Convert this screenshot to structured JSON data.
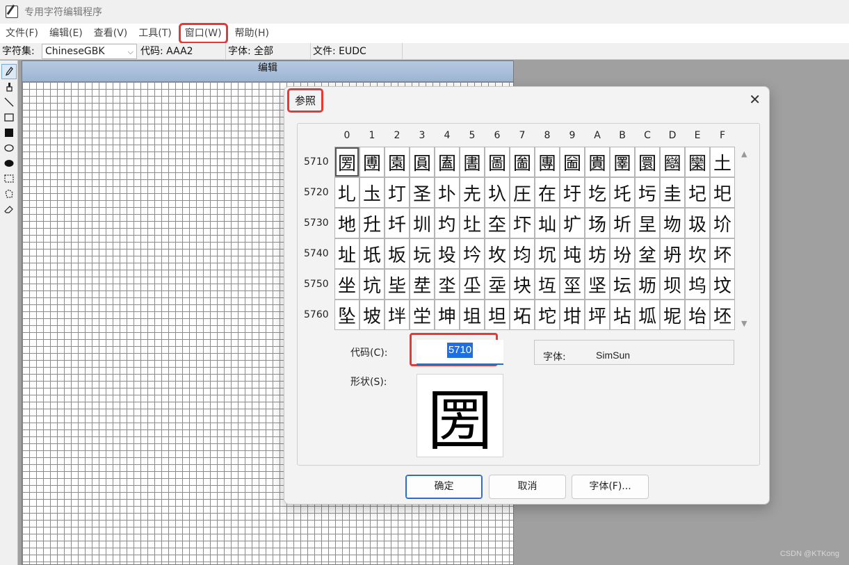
{
  "app": {
    "title": "专用字符编辑程序"
  },
  "menu": [
    {
      "label": "文件(F)"
    },
    {
      "label": "编辑(E)"
    },
    {
      "label": "查看(V)"
    },
    {
      "label": "工具(T)"
    },
    {
      "label": "窗口(W)"
    },
    {
      "label": "帮助(H)"
    }
  ],
  "infobar": {
    "charset_label": "字符集:",
    "charset_value": "ChineseGBK",
    "code": "代码: AAA2",
    "font": "字体: 全部",
    "file": "文件: EUDC"
  },
  "toolbar": {
    "tools": [
      "pencil-icon",
      "brush-icon",
      "line-icon",
      "hollow-rect-icon",
      "filled-rect-icon",
      "hollow-ellipse-icon",
      "filled-ellipse-icon",
      "rect-select-icon",
      "freeform-select-icon",
      "eraser-icon"
    ]
  },
  "edit": {
    "header": "编辑"
  },
  "dialog": {
    "title": "参照",
    "close": "✕",
    "columns": [
      "0",
      "1",
      "2",
      "3",
      "4",
      "5",
      "6",
      "7",
      "8",
      "9",
      "A",
      "B",
      "C",
      "D",
      "E",
      "F"
    ],
    "rows": [
      {
        "code": "5710",
        "chars": [
          "圐",
          "圑",
          "園",
          "圓",
          "圔",
          "圕",
          "圖",
          "圗",
          "團",
          "圙",
          "圚",
          "圛",
          "圜",
          "圝",
          "圞",
          "土"
        ]
      },
      {
        "code": "5720",
        "chars": [
          "圠",
          "圡",
          "圢",
          "圣",
          "圤",
          "圥",
          "圦",
          "圧",
          "在",
          "圩",
          "圪",
          "圫",
          "圬",
          "圭",
          "圮",
          "圯"
        ]
      },
      {
        "code": "5730",
        "chars": [
          "地",
          "圱",
          "圲",
          "圳",
          "圴",
          "圵",
          "圶",
          "圷",
          "圸",
          "圹",
          "场",
          "圻",
          "圼",
          "圽",
          "圾",
          "圿"
        ]
      },
      {
        "code": "5740",
        "chars": [
          "址",
          "坁",
          "坂",
          "坃",
          "坄",
          "坅",
          "坆",
          "均",
          "坈",
          "坉",
          "坊",
          "坋",
          "坌",
          "坍",
          "坎",
          "坏"
        ]
      },
      {
        "code": "5750",
        "chars": [
          "坐",
          "坑",
          "坒",
          "坓",
          "坔",
          "坕",
          "坖",
          "块",
          "坘",
          "坙",
          "坚",
          "坛",
          "坜",
          "坝",
          "坞",
          "坟"
        ]
      },
      {
        "code": "5760",
        "chars": [
          "坠",
          "坡",
          "坢",
          "坣",
          "坤",
          "坥",
          "坦",
          "坧",
          "坨",
          "坩",
          "坪",
          "坫",
          "坬",
          "坭",
          "坮",
          "坯"
        ]
      }
    ],
    "code_label": "代码(C):",
    "code_value": "5710",
    "font_label": "字体:",
    "font_value": "SimSun",
    "shape_label": "形状(S):",
    "shape_char": "圐",
    "buttons": {
      "ok": "确定",
      "cancel": "取消",
      "font": "字体(F)..."
    }
  },
  "watermark": "CSDN @KTKong"
}
